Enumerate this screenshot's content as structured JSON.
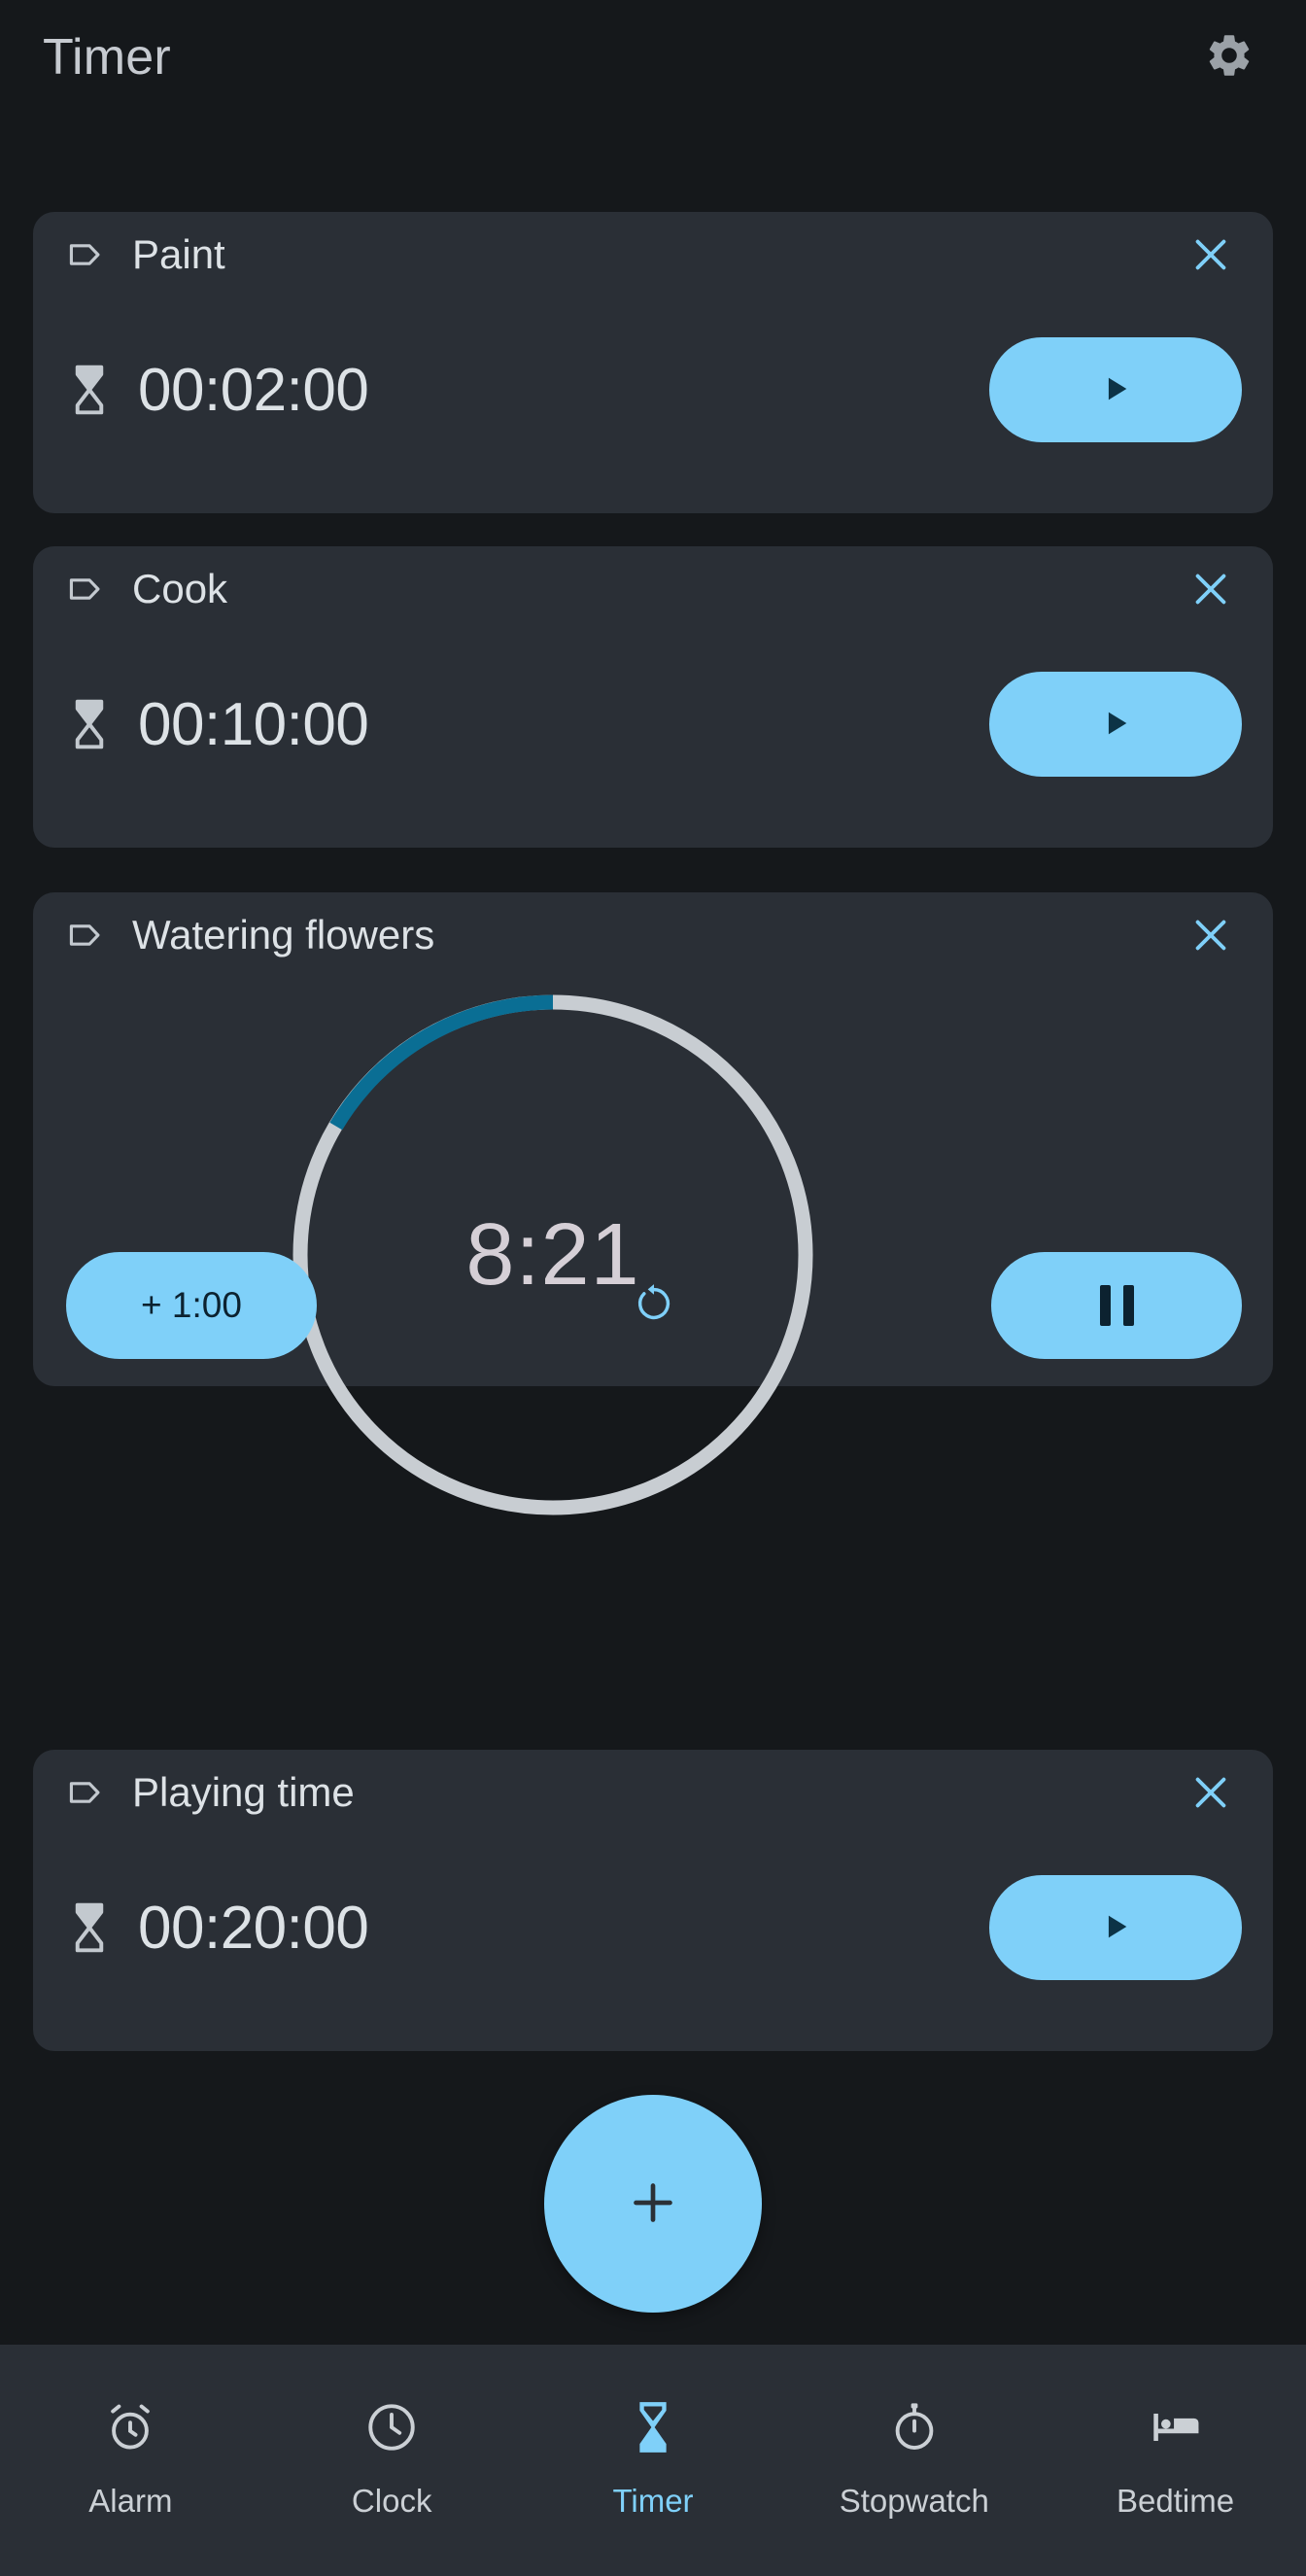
{
  "header": {
    "title": "Timer",
    "settings_icon": "gear-icon"
  },
  "colors": {
    "page_background": "#15181B",
    "card_background": "#2A2F36",
    "accent": "#7FD0F9",
    "accent_dark": "#0C2230",
    "progress_track": "#C8CDD2",
    "progress_fill": "#0A6E94",
    "text_primary": "#DDE2E6",
    "text_secondary": "#C6CAD0"
  },
  "timers": [
    {
      "label": "Paint",
      "duration": "00:02:00",
      "state": "idle",
      "label_icon": "tag-icon",
      "time_icon": "hourglass-icon",
      "close_icon": "close-icon",
      "action_icon": "play-icon"
    },
    {
      "label": "Cook",
      "duration": "00:10:00",
      "state": "idle",
      "label_icon": "tag-icon",
      "time_icon": "hourglass-icon",
      "close_icon": "close-icon",
      "action_icon": "play-icon"
    },
    {
      "label": "Watering flowers",
      "remaining": "8:21",
      "state": "running",
      "label_icon": "tag-icon",
      "close_icon": "close-icon",
      "add_minute_label": "+ 1:00",
      "reset_icon": "reset-icon",
      "action_icon": "pause-icon",
      "progress_percent": 27
    },
    {
      "label": "Playing time",
      "duration": "00:20:00",
      "state": "idle",
      "label_icon": "tag-icon",
      "time_icon": "hourglass-icon",
      "close_icon": "close-icon",
      "action_icon": "play-icon"
    }
  ],
  "fab": {
    "icon": "plus-icon"
  },
  "bottom_nav": {
    "items": [
      {
        "label": "Alarm",
        "icon": "alarm-clock-icon",
        "active": false
      },
      {
        "label": "Clock",
        "icon": "clock-icon",
        "active": false
      },
      {
        "label": "Timer",
        "icon": "hourglass-icon",
        "active": true
      },
      {
        "label": "Stopwatch",
        "icon": "stopwatch-icon",
        "active": false
      },
      {
        "label": "Bedtime",
        "icon": "bed-icon",
        "active": false
      }
    ]
  }
}
